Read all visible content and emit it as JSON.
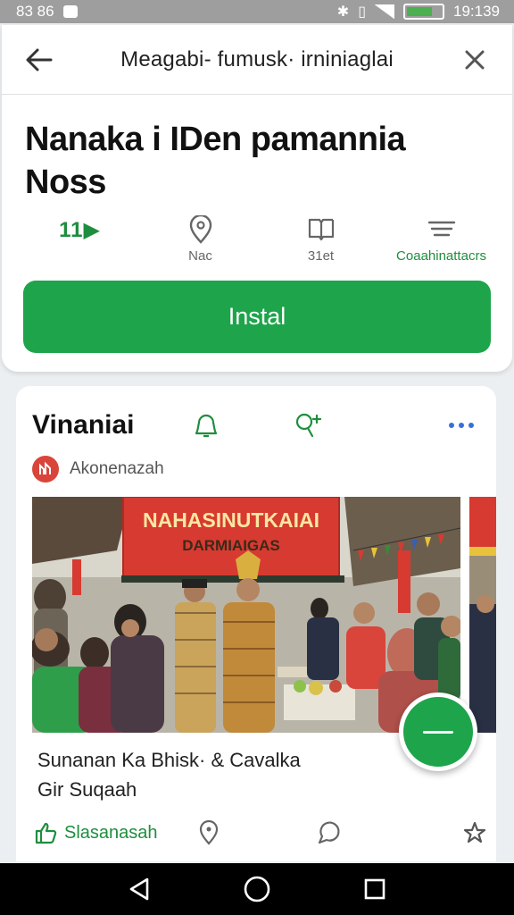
{
  "status_bar": {
    "left_text": "83 86",
    "time": "19:139"
  },
  "toolbar": {
    "title": "Meagabi- fumusk· irniniaglai",
    "back_icon": "arrow-left-icon",
    "close_icon": "close-icon"
  },
  "app": {
    "name": "Nanaka i IDen pamannia Noss",
    "meta": [
      {
        "icon": "rating-icon",
        "value": "11▶",
        "label": ""
      },
      {
        "icon": "map-pin-icon",
        "value": "",
        "label": "Nac"
      },
      {
        "icon": "book-icon",
        "value": "",
        "label": "31et"
      },
      {
        "icon": "list-icon",
        "value": "",
        "label": "Coaahinattacrs"
      }
    ],
    "install_label": "Instal"
  },
  "post": {
    "title": "Vinaniai",
    "author": "Akonenazah",
    "banner_line1": "NAHASINUTKAIAI",
    "banner_line2": "DARMIAIGAS",
    "caption_line1": "Sunanan Ka Bhisk· & Cavalka",
    "caption_line2": "Gir Suqaah",
    "like_label": "Slasanasah"
  },
  "colors": {
    "accent_green": "#1ea44b",
    "status_bar": "#9e9e9e",
    "banner_red": "#d73a31"
  }
}
